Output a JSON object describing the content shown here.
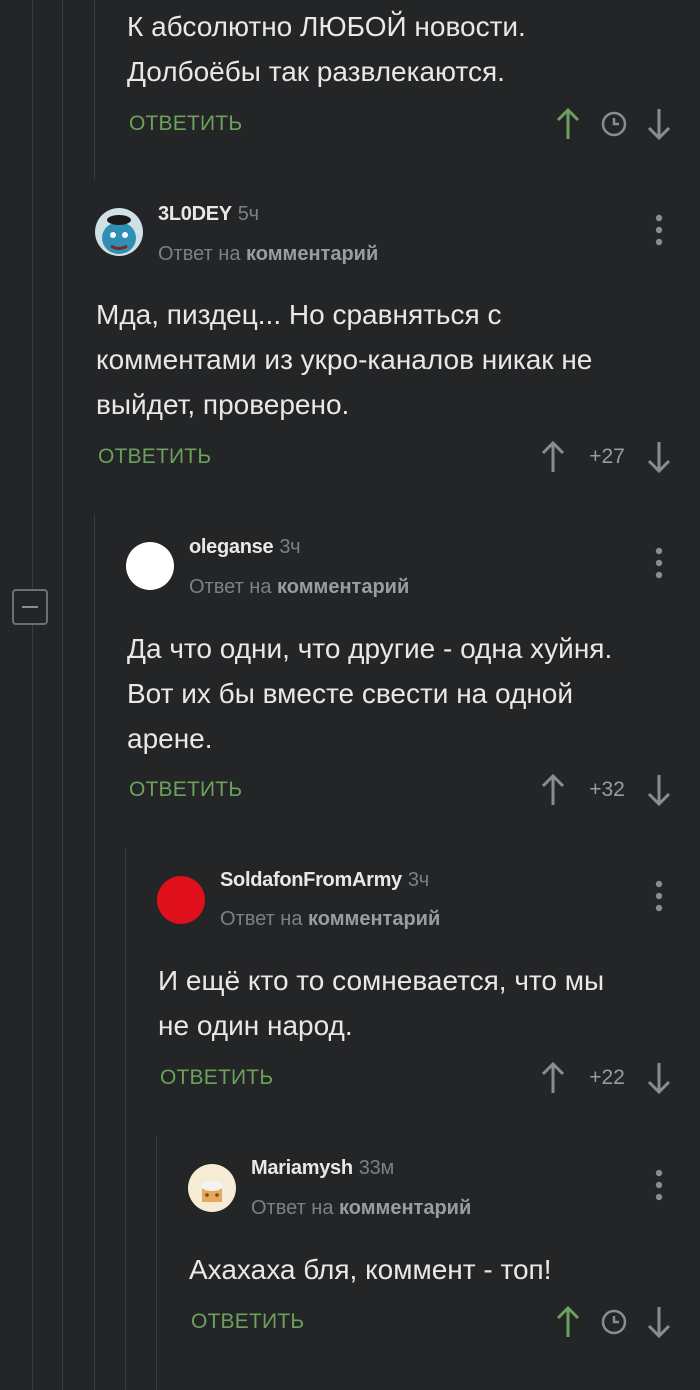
{
  "comments": [
    {
      "author": "",
      "time": "",
      "reply_prefix": "",
      "reply_target": "",
      "text": "К абсолютно ЛЮБОЙ новости.\nДолбоёбы так развлекаются.",
      "reply_label": "ОТВЕТИТЬ",
      "rating": ""
    },
    {
      "author": "3L0DEY",
      "time": "5ч",
      "reply_prefix": "Ответ на",
      "reply_target": "комментарий",
      "text": "Мда, пиздец... Но сравняться с\nкомментами из укро-каналов никак не\nвыйдет, проверено.",
      "reply_label": "ОТВЕТИТЬ",
      "rating": "+27"
    },
    {
      "author": "oleganse",
      "time": "3ч",
      "reply_prefix": "Ответ на",
      "reply_target": "комментарий",
      "text": "Да что одни, что другие - одна хуйня.\nВот их бы вместе свести на одной\nарене.",
      "reply_label": "ОТВЕТИТЬ",
      "rating": "+32"
    },
    {
      "author": "SoldafonFromArmy",
      "time": "3ч",
      "reply_prefix": "Ответ на",
      "reply_target": "комментарий",
      "text": "И ещё кто то сомневается, что мы\nне один народ.",
      "reply_label": "ОТВЕТИТЬ",
      "rating": "+22"
    },
    {
      "author": "Mariamysh",
      "time": "33м",
      "reply_prefix": "Ответ на",
      "reply_target": "комментарий",
      "text": "Ахахаха бля, коммент - топ!",
      "reply_label": "ОТВЕТИТЬ",
      "rating": ""
    }
  ],
  "colors": {
    "background": "#232527",
    "accent_green": "#6da15b",
    "muted_text": "#7d8083",
    "thread_line": "#3b3e41"
  },
  "icons": {
    "upvote": "arrow-up-icon",
    "downvote": "arrow-down-icon",
    "pending_rating": "clock-icon",
    "menu": "more-vertical-icon",
    "collapse": "minus-square-icon"
  }
}
